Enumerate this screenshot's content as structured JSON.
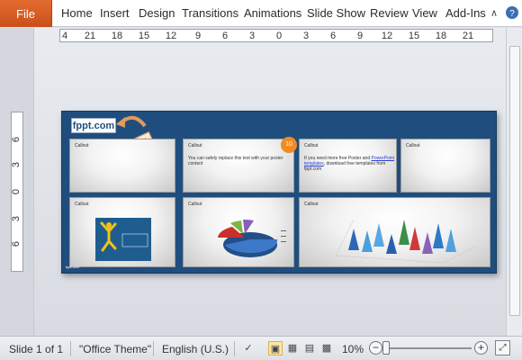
{
  "ribbon": {
    "file": "File",
    "tabs": [
      "Home",
      "Insert",
      "Design",
      "Transitions",
      "Animations",
      "Slide Show",
      "Review",
      "View",
      "Add-Ins"
    ]
  },
  "rulers": {
    "horizontal": [
      "4",
      "21",
      "18",
      "15",
      "12",
      "9",
      "6",
      "3",
      "0",
      "3",
      "6",
      "9",
      "12",
      "15",
      "18",
      "21"
    ],
    "vertical": [
      "6",
      "3",
      "0",
      "3",
      "6"
    ]
  },
  "slide": {
    "logo": "fppt.com",
    "logo_tag": "Put your logo here",
    "badge": "10",
    "footer": "fppt.com",
    "cards": {
      "c1": {
        "title": "Callout"
      },
      "c2": {
        "title": "Callout",
        "body": "You can safely replace this text with your poster content"
      },
      "c3": {
        "title": "Callout",
        "body_pre": "If you need more free Poster and",
        "body_link": "PowerPoint templates",
        "body_post": ", download free templates from fppt.com"
      },
      "c4": {
        "title": "Callout"
      },
      "c5": {
        "title": "Callout"
      },
      "c6": {
        "title": "Callout"
      },
      "c7": {
        "title": "Callout"
      }
    }
  },
  "status": {
    "slide": "Slide 1 of 1",
    "theme": "\"Office Theme\"",
    "language": "English (U.S.)",
    "zoom": "10%",
    "zoom_level": 0.1
  },
  "colors": {
    "accent": "#d24726",
    "slide_bg": "#1f4e7e"
  }
}
